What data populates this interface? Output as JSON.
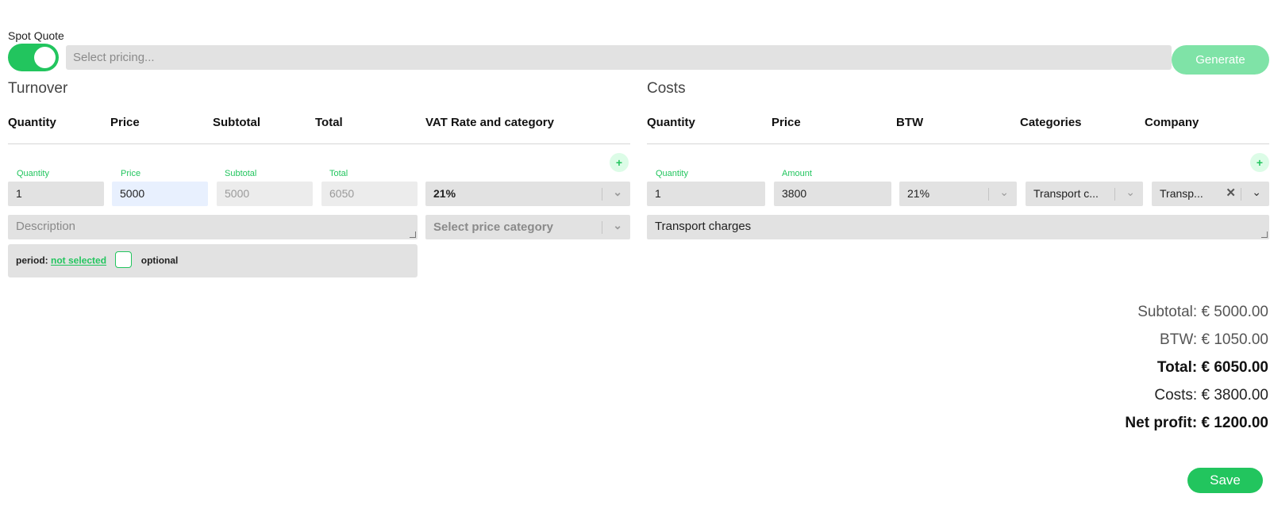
{
  "spot_quote": {
    "label": "Spot Quote",
    "pricing_placeholder": "Select pricing...",
    "generate_label": "Generate"
  },
  "turnover": {
    "title": "Turnover",
    "headers": [
      "Quantity",
      "Price",
      "Subtotal",
      "Total",
      "VAT Rate and category"
    ],
    "add_symbol": "+",
    "field_labels": {
      "quantity": "Quantity",
      "price": "Price",
      "subtotal": "Subtotal",
      "total": "Total"
    },
    "values": {
      "quantity": "1",
      "price": "5000",
      "subtotal": "5000",
      "total": "6050"
    },
    "vat_rate": "21%",
    "description_placeholder": "Description",
    "price_category_placeholder": "Select price category",
    "period_label": "period:",
    "period_value": "not selected",
    "optional_label": "optional"
  },
  "costs": {
    "title": "Costs",
    "headers": [
      "Quantity",
      "Price",
      "BTW",
      "Categories",
      "Company"
    ],
    "add_symbol": "+",
    "field_labels": {
      "quantity": "Quantity",
      "amount": "Amount"
    },
    "values": {
      "quantity": "1",
      "amount": "3800"
    },
    "btw": "21%",
    "category": "Transport c...",
    "company": "Transp...",
    "description": "Transport charges"
  },
  "summary": {
    "subtotal": "Subtotal: € 5000.00",
    "btw": "BTW: € 1050.00",
    "total": "Total: € 6050.00",
    "costs": "Costs: € 3800.00",
    "net_profit": "Net profit: € 1200.00"
  },
  "save_label": "Save",
  "colors": {
    "accent": "#22c55e",
    "accent_light": "#7fe3a7",
    "field_bg": "#e2e2e2"
  }
}
